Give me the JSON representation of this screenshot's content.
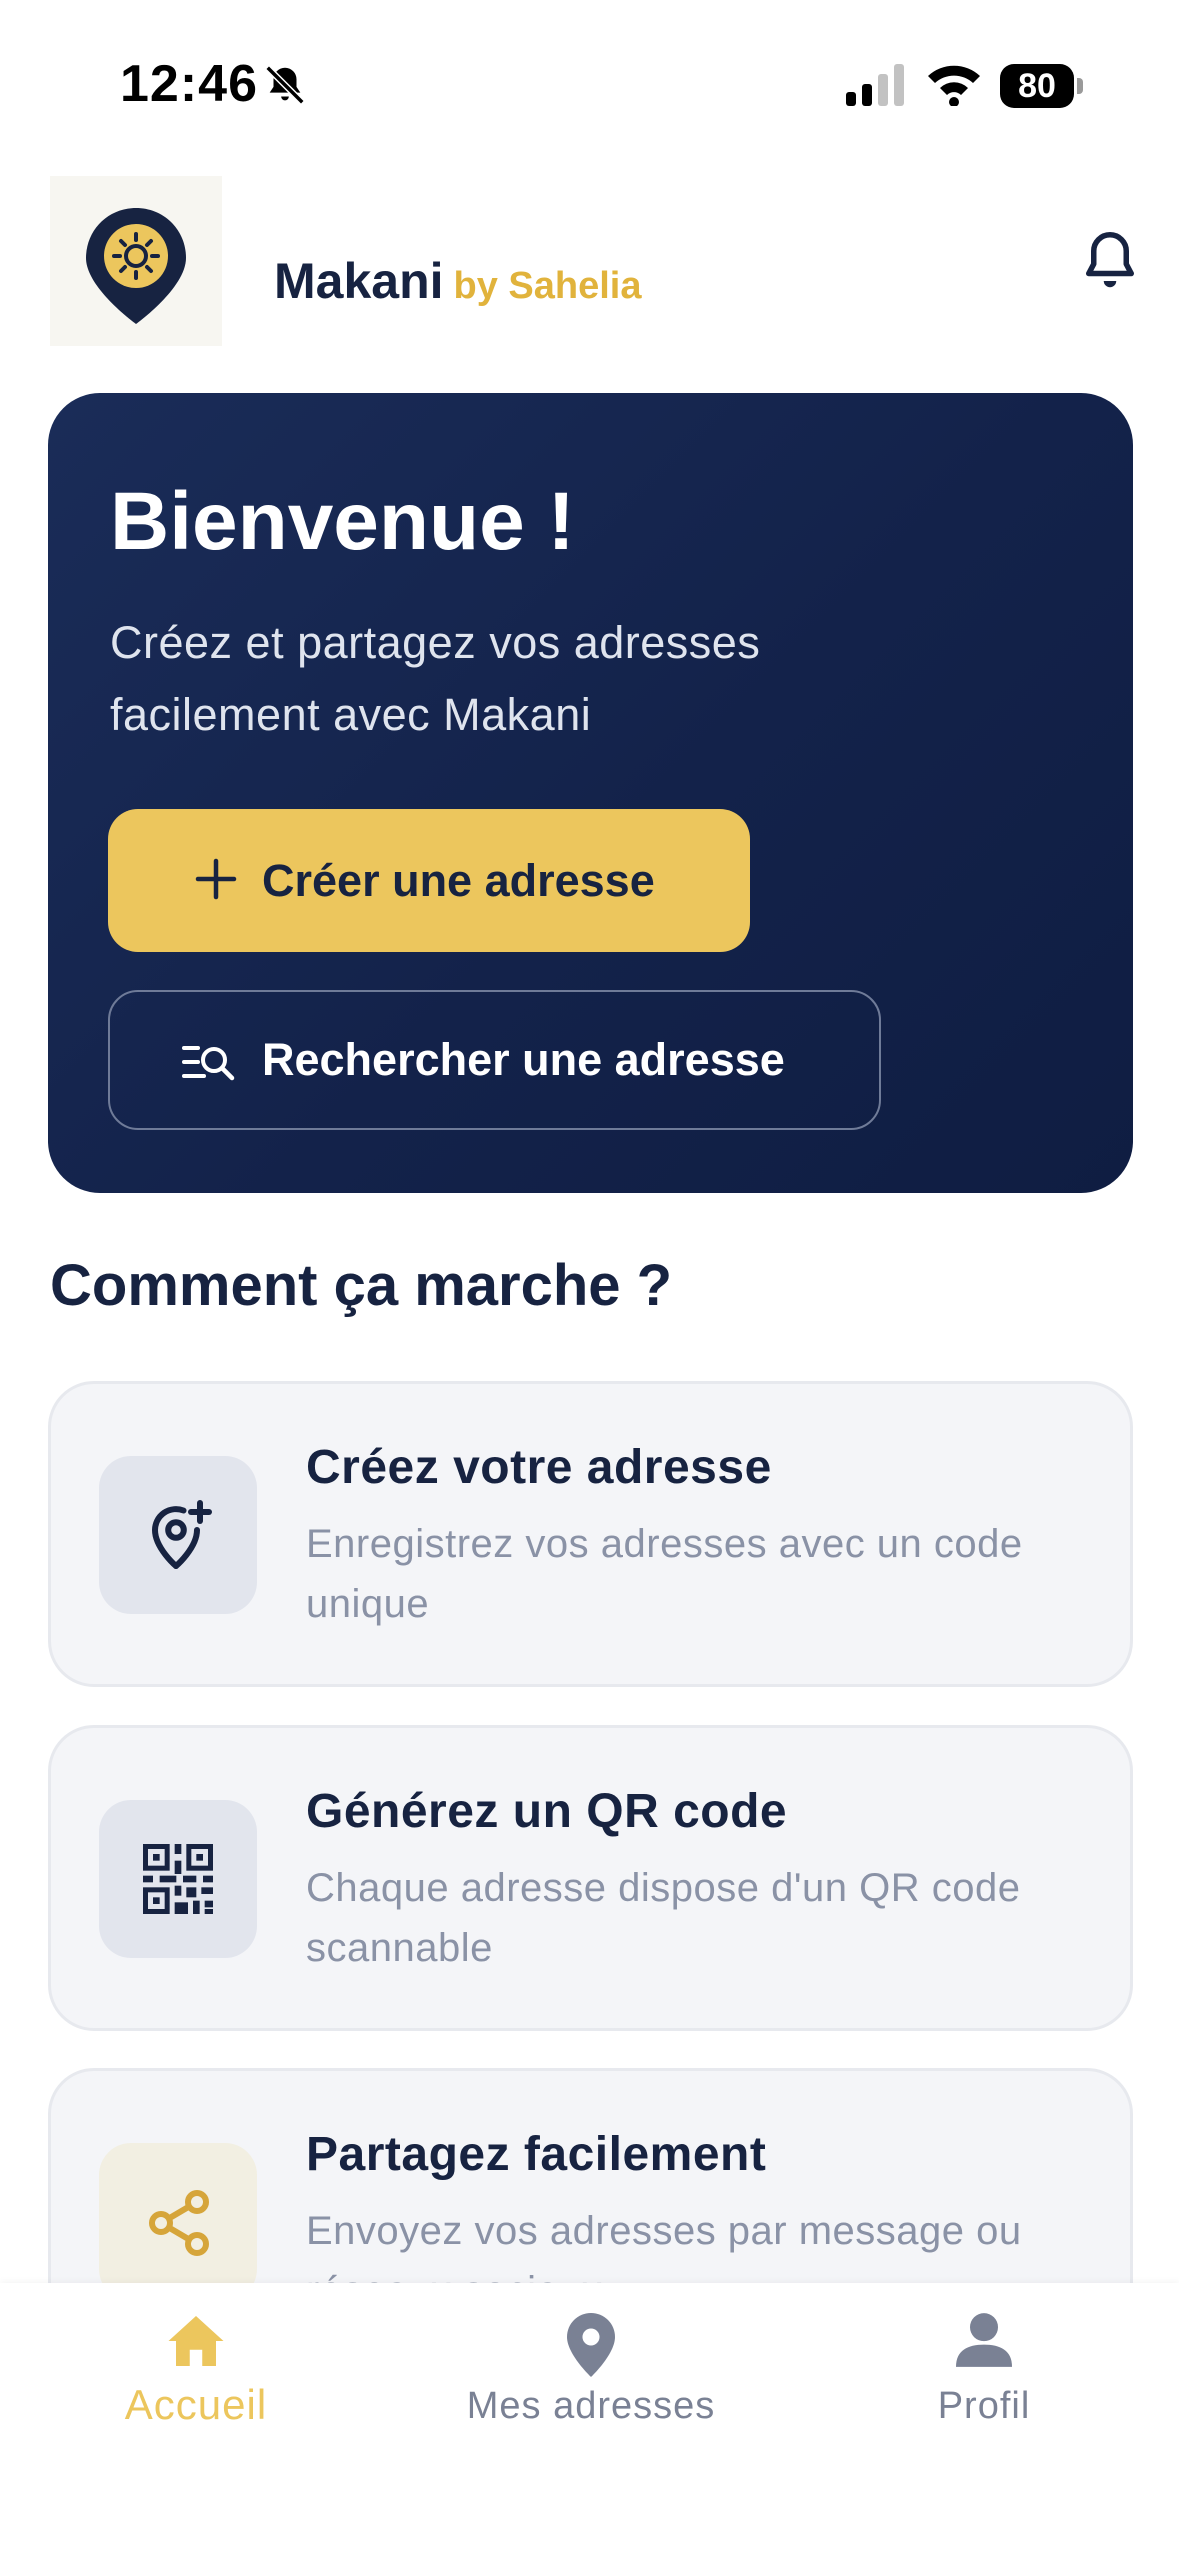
{
  "status_bar": {
    "time": "12:46",
    "battery": "80",
    "icons": [
      "bell-slash-icon",
      "cellular-signal-icon",
      "wifi-icon",
      "battery-icon"
    ]
  },
  "header": {
    "brand_name": "Makani",
    "brand_by": "by Sahelia",
    "logo_icon": "map-pin-sun-icon",
    "notification_icon": "bell-icon"
  },
  "hero": {
    "title": "Bienvenue !",
    "subtitle": "Créez et partagez vos adresses facilement avec Makani",
    "create_button": "Créer une adresse",
    "search_button": "Rechercher une adresse"
  },
  "how_it_works": {
    "title": "Comment ça marche ?",
    "steps": [
      {
        "title": "Créez votre adresse",
        "description": "Enregistrez vos adresses avec un code unique",
        "icon": "location-add-icon"
      },
      {
        "title": "Générez un QR code",
        "description": "Chaque adresse dispose d'un QR code scannable",
        "icon": "qr-code-icon"
      },
      {
        "title": "Partagez facilement",
        "description": "Envoyez vos adresses par message ou réseaux sociaux",
        "icon": "share-icon"
      }
    ]
  },
  "bottom_nav": {
    "items": [
      {
        "label": "Accueil",
        "icon": "home-icon",
        "active": true
      },
      {
        "label": "Mes adresses",
        "icon": "map-pin-icon",
        "active": false
      },
      {
        "label": "Profil",
        "icon": "person-icon",
        "active": false
      }
    ]
  },
  "colors": {
    "navy": "#172341",
    "gold": "#ECC65D",
    "hero_bg": "#13224A",
    "muted": "#8A92A6"
  }
}
